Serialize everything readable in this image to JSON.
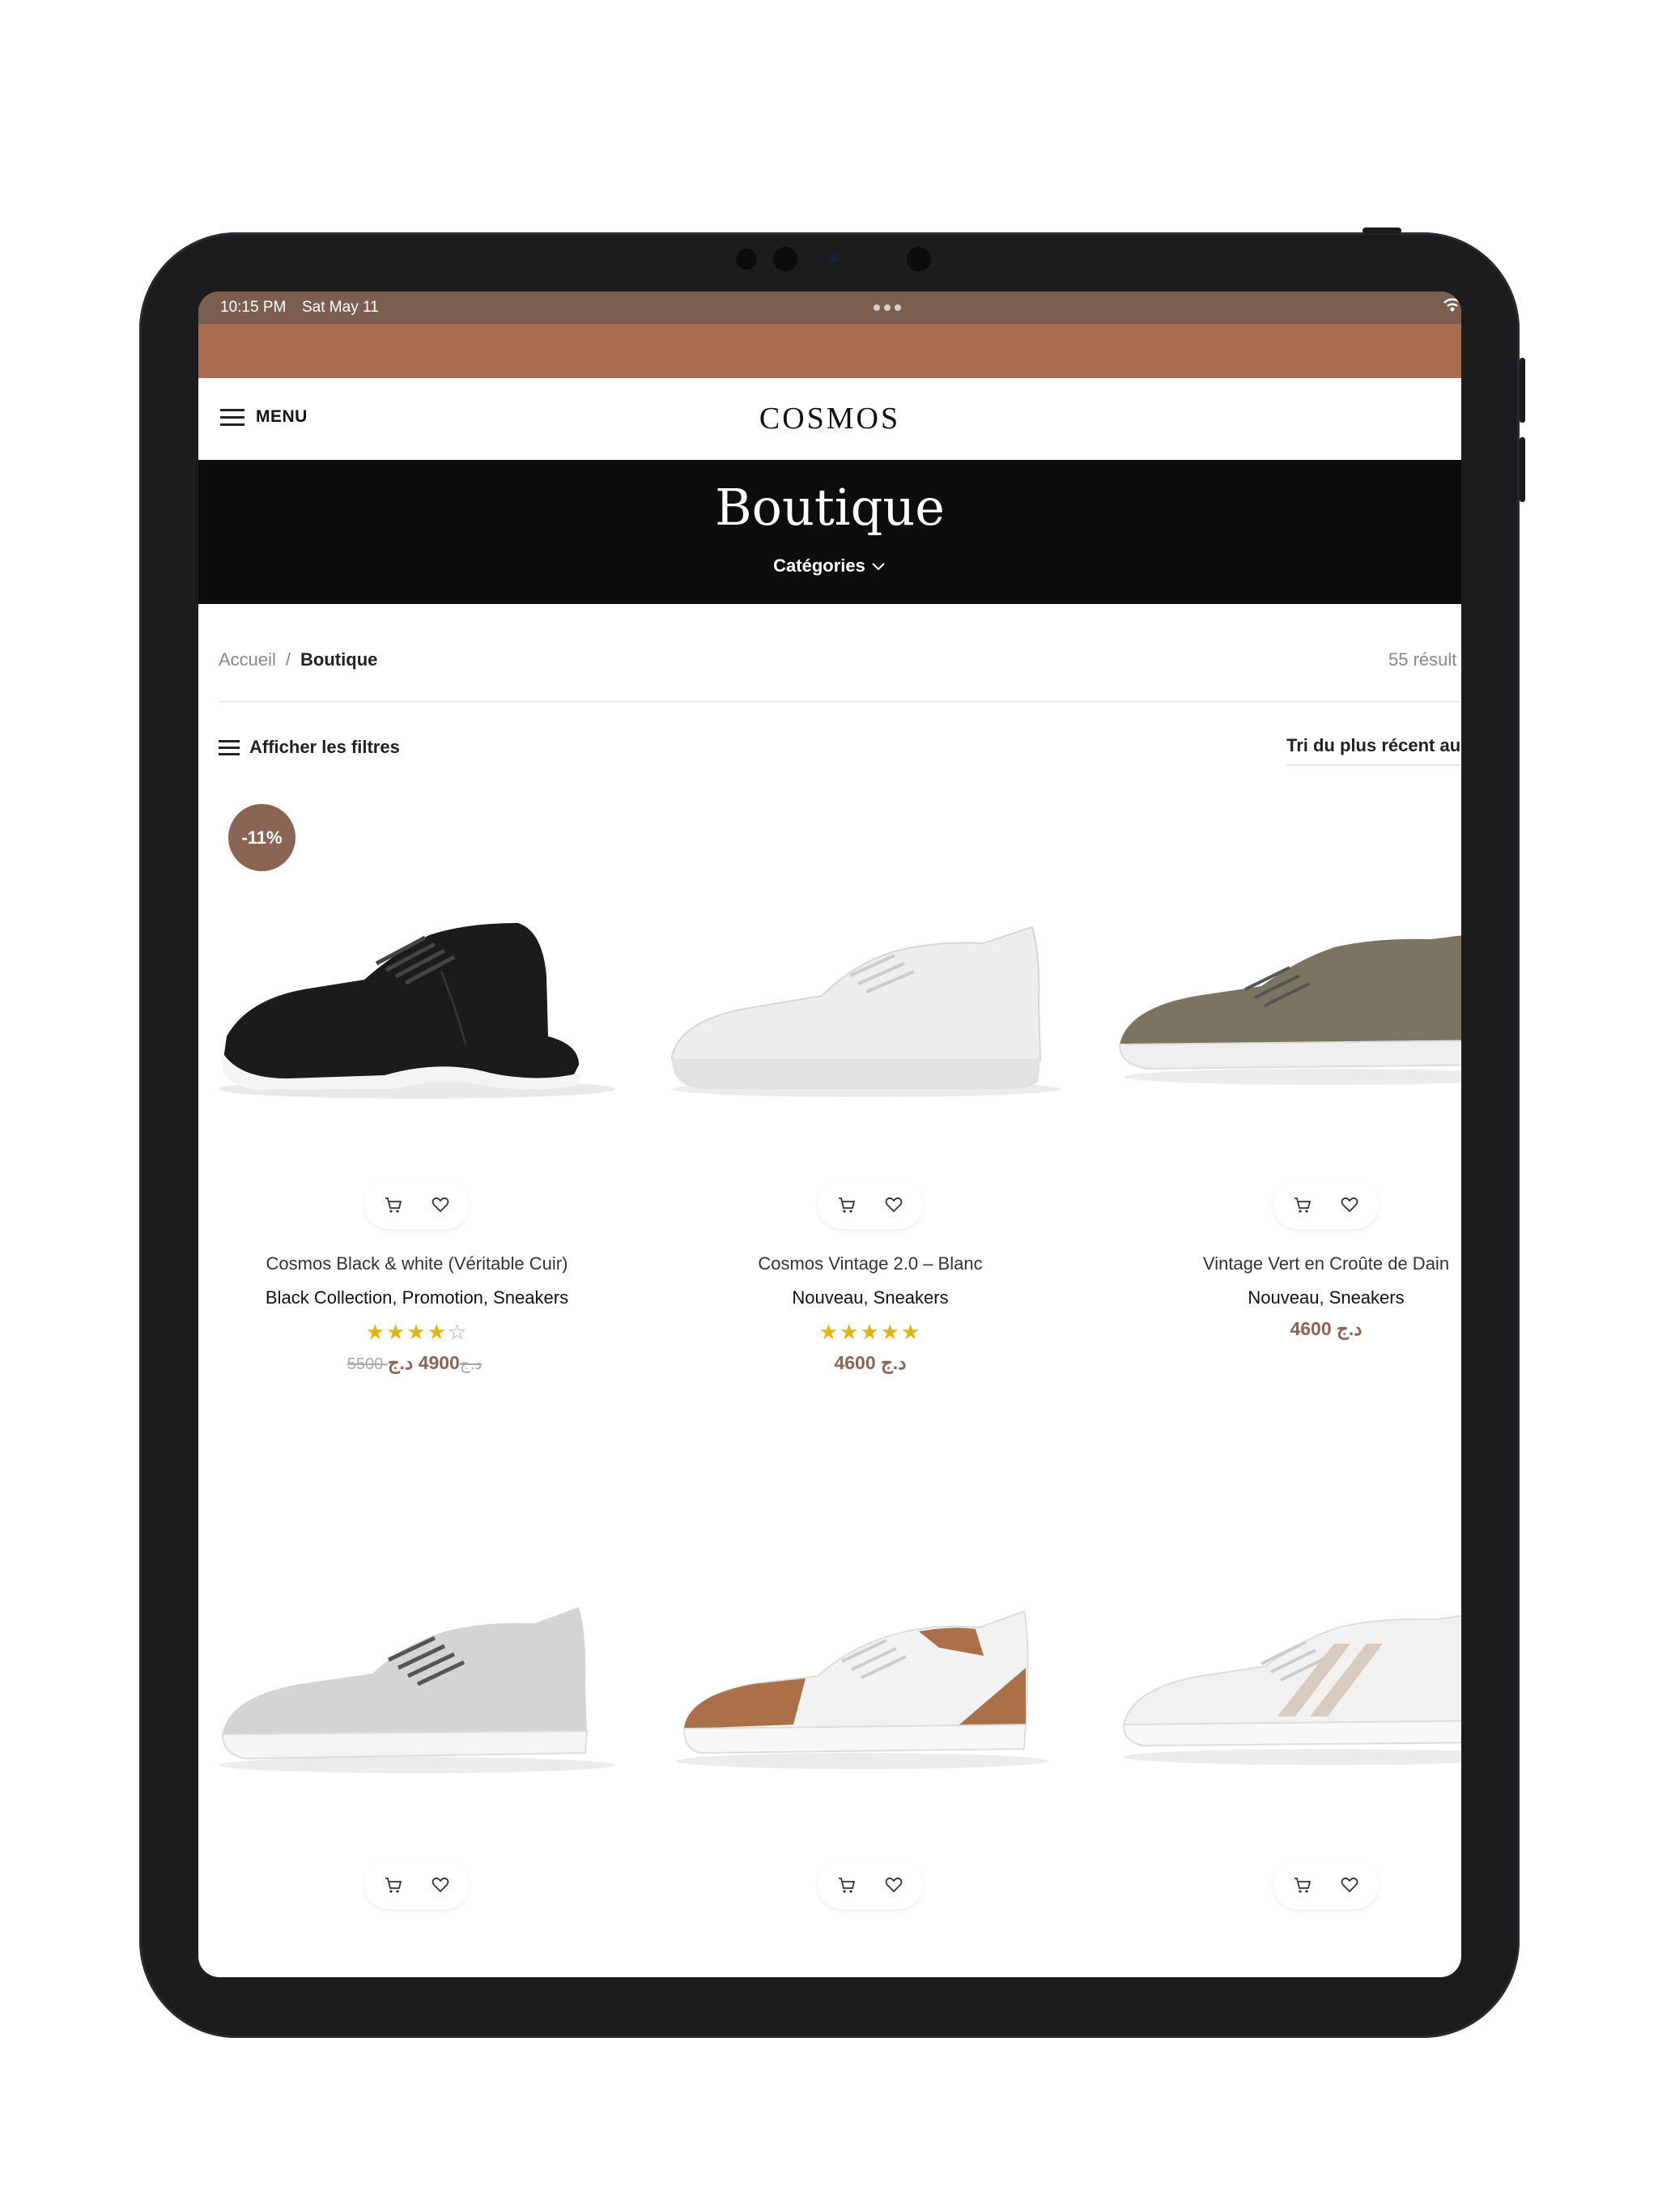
{
  "status_bar": {
    "time": "10:15 PM",
    "date": "Sat May 11"
  },
  "header": {
    "menu_label": "MENU",
    "logo": "COSMOS"
  },
  "hero": {
    "title": "Boutique",
    "categories_label": "Catégories"
  },
  "breadcrumb": {
    "home": "Accueil",
    "separator": "/",
    "current": "Boutique"
  },
  "results": "55 résult",
  "toolbar": {
    "filters_label": "Afficher les filtres",
    "sort_label": "Tri du plus récent au"
  },
  "colors": {
    "accent": "#a86c50",
    "status_bar": "#7b5e4f",
    "hero_bg": "#0d0c0e",
    "price": "#8a6555",
    "star": "#e2b40e"
  },
  "products": [
    {
      "badge": "-11%",
      "name": "Cosmos Black & white (Véritable Cuir)",
      "categories": "Black Collection, Promotion, Sneakers",
      "rating": 4,
      "old_price": "5500 د.ج",
      "price": "4900 د.ج",
      "color": "black"
    },
    {
      "name": "Cosmos Vintage 2.0 – Blanc",
      "categories": "Nouveau, Sneakers",
      "rating": 5,
      "price": "4600 د.ج",
      "color": "white"
    },
    {
      "name": "Vintage Vert en Croûte de Dain",
      "categories": "Nouveau, Sneakers",
      "price": "4600 د.ج",
      "color": "olive"
    },
    {
      "color": "grey"
    },
    {
      "color": "white-tan"
    },
    {
      "color": "white-stripe"
    }
  ]
}
